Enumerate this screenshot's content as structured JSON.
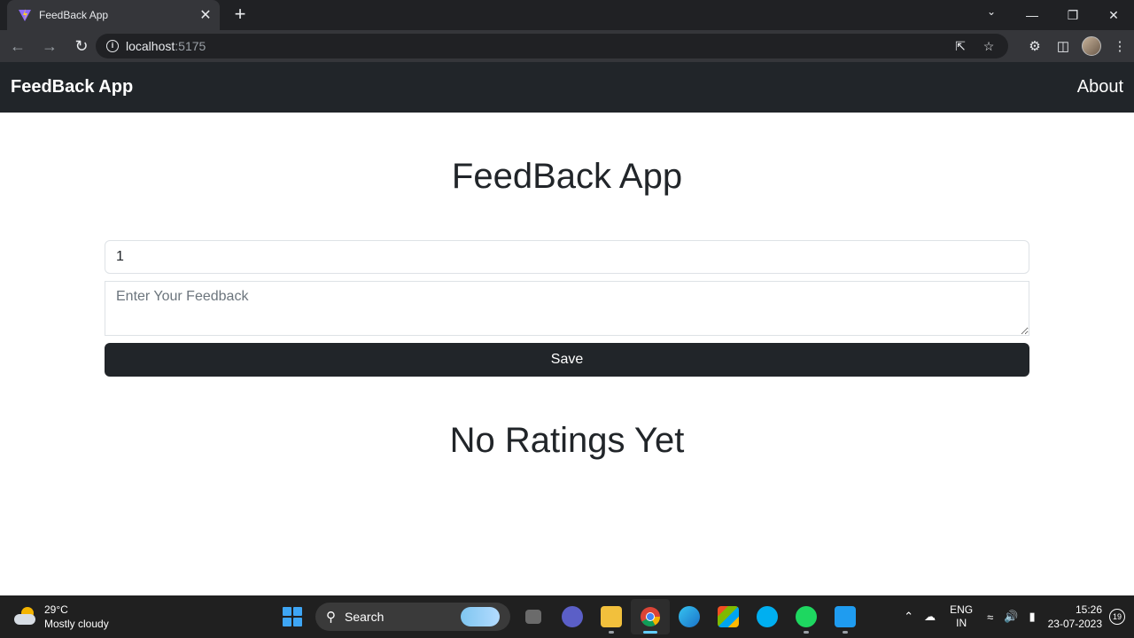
{
  "browser": {
    "tab_title": "FeedBack App",
    "tab_close": "✕",
    "new_tab": "+",
    "url_host": "localhost",
    "url_port": ":5175"
  },
  "navbar": {
    "brand": "FeedBack App",
    "about": "About"
  },
  "main": {
    "title": "FeedBack App",
    "rating_value": "1",
    "feedback_placeholder": "Enter Your Feedback",
    "save_label": "Save",
    "empty_message": "No Ratings Yet"
  },
  "taskbar": {
    "temperature": "29°C",
    "weather": "Mostly cloudy",
    "search_label": "Search",
    "lang_primary": "ENG",
    "lang_secondary": "IN",
    "time": "15:26",
    "date": "23-07-2023",
    "notifications": "19"
  },
  "colors": {
    "navbar_bg": "#212529",
    "button_bg": "#212529",
    "browser_dark": "#202124",
    "browser_toolbar": "#35363a",
    "taskbar_bg": "#202020"
  }
}
